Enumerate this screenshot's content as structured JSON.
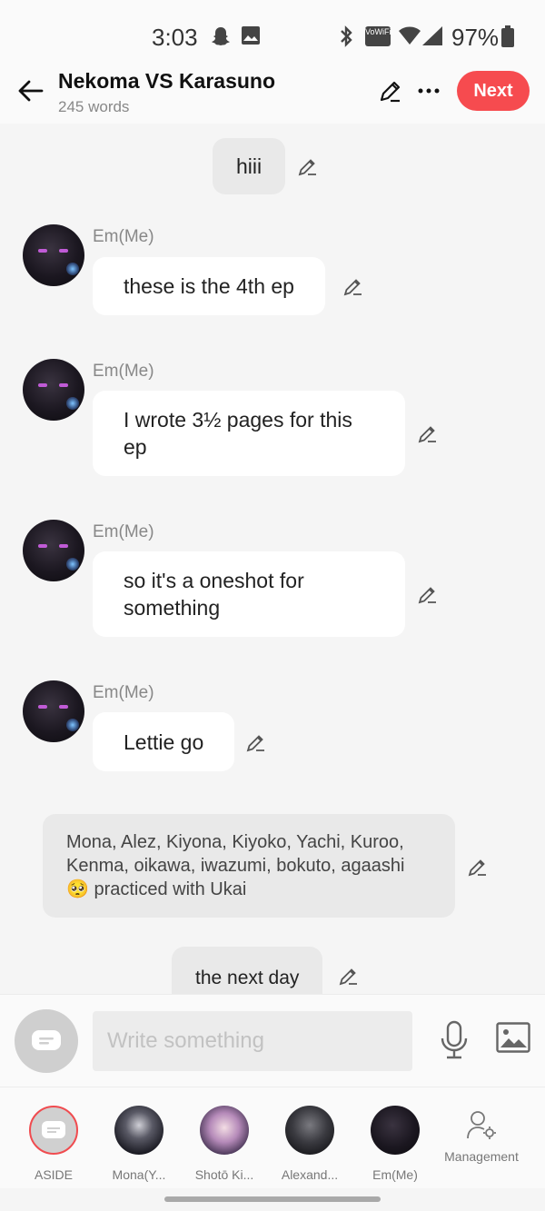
{
  "status_bar": {
    "time": "3:03",
    "network_badge": "VoWiFi",
    "battery": "97%"
  },
  "header": {
    "title": "Nekoma VS Karasuno",
    "word_count": "245 words",
    "next_label": "Next"
  },
  "messages": [
    {
      "type": "center",
      "text": "hiii"
    },
    {
      "type": "character",
      "name": "Em(Me)",
      "text": "these is the 4th ep"
    },
    {
      "type": "character",
      "name": "Em(Me)",
      "text": "I wrote 3½ pages for this ep"
    },
    {
      "type": "character",
      "name": "Em(Me)",
      "text": "so it's a oneshot for something"
    },
    {
      "type": "character",
      "name": "Em(Me)",
      "text": "Lettie go"
    },
    {
      "type": "narration",
      "text": "Mona, Alez, Kiyona, Kiyoko, Yachi, Kuroo, Kenma, oikawa, iwazumi, bokuto, agaashi 🥺 practiced with Ukai"
    },
    {
      "type": "center",
      "text": "the next day"
    }
  ],
  "composer": {
    "placeholder": "Write something"
  },
  "characters": [
    {
      "label": "ASIDE",
      "selected": true
    },
    {
      "label": "Mona(Y..."
    },
    {
      "label": "Shotō Ki..."
    },
    {
      "label": "Alexand..."
    },
    {
      "label": "Em(Me)"
    },
    {
      "label": "Management"
    }
  ],
  "colors": {
    "accent": "#f64b4f",
    "bubble": "#ffffff",
    "narration_bg": "#e9e9e9",
    "background": "#f5f5f5"
  }
}
